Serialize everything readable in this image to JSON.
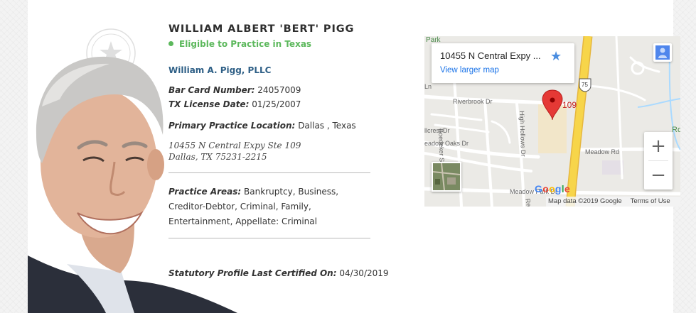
{
  "attorney": {
    "name": "WILLIAM ALBERT 'BERT' PIGG",
    "eligibility": "Eligible to Practice in Texas",
    "firm": "William A. Pigg, PLLC",
    "bar_card_label": "Bar Card Number:",
    "bar_card_value": "24057009",
    "license_date_label": "TX License Date:",
    "license_date_value": "01/25/2007",
    "location_label": "Primary Practice Location:",
    "location_value": "Dallas , Texas",
    "address_line1": "10455 N Central Expy Ste 109",
    "address_line2": "Dallas, TX 75231-2215",
    "practice_areas_label": "Practice Areas:",
    "practice_areas_value": "Bankruptcy, Business, Creditor-Debtor, Criminal, Family, Entertainment, Appellate: Criminal",
    "certified_label": "Statutory Profile Last Certified On:",
    "certified_value": "04/30/2019"
  },
  "map": {
    "place_title": "10455 N Central Expy ...",
    "view_larger": "View larger map",
    "pin_label": "109",
    "highway_shield": "75",
    "streets": {
      "park": "Park",
      "ln": "Ln",
      "riverbrook": "Riverbrook Dr",
      "hillcrest": "llcrest Dr",
      "boedeker": "Boedeker St",
      "high_hollows": "High Hollows Dr",
      "meadow_oaks": "eadow Oaks Dr",
      "meadow_rd": "Meadow Rd",
      "meadow_park": "Meadow Park Dr",
      "re": "Re",
      "ro": "Ro"
    },
    "logo_text": "Google",
    "attribution": "Map data ©2019 Google",
    "terms": "Terms of Use",
    "zoom_in": "+",
    "zoom_out": "−",
    "colors": {
      "highway": "#f7d54a",
      "pin": "#e53935",
      "link": "#1a73e8",
      "eligible_green": "#5cb85c"
    }
  }
}
